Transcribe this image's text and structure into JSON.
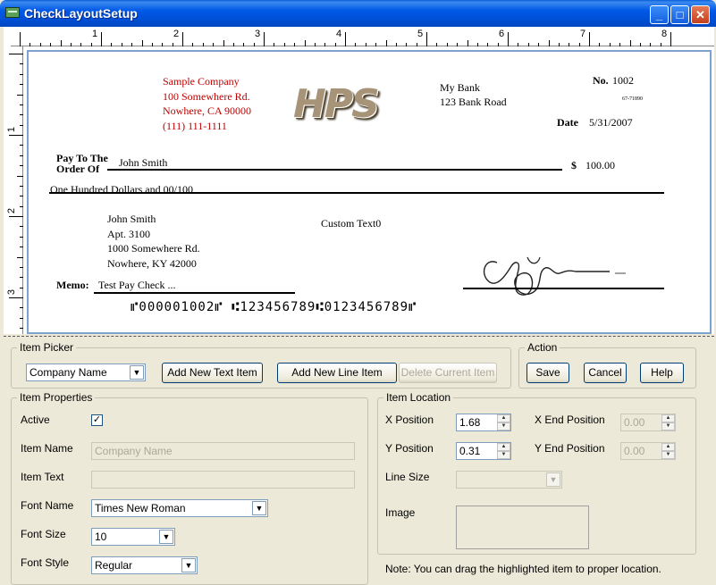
{
  "window": {
    "title": "CheckLayoutSetup",
    "controls": {
      "minimize": "_",
      "maximize": "□",
      "close": "✕"
    }
  },
  "ruler": {
    "horizontal": [
      "1",
      "2",
      "3",
      "4",
      "5",
      "6",
      "7",
      "8"
    ],
    "vertical": [
      "1",
      "2",
      "3"
    ]
  },
  "check": {
    "company": {
      "name": "Sample Company",
      "address1": "100 Somewhere Rd.",
      "address2": "Nowhere, CA 90000",
      "phone": "(111) 111-1111"
    },
    "logo": "HPS",
    "bank": {
      "name": "My Bank",
      "address": "123 Bank Road"
    },
    "number_label": "No.",
    "number": "1002",
    "fraction": "67-71890",
    "date_label": "Date",
    "date": "5/31/2007",
    "payto_label_1": "Pay To The",
    "payto_label_2": "Order Of",
    "payee": "John Smith",
    "currency": "$",
    "amount": "100.00",
    "amount_words": "One Hundred  Dollars and 00/100",
    "payee_address": {
      "name": "John Smith",
      "line1": "Apt. 3100",
      "line2": "1000 Somewhere Rd.",
      "line3": "Nowhere, KY 42000"
    },
    "custom_text": "Custom Text0",
    "memo_label": "Memo:",
    "memo": "Test Pay Check ...",
    "micr": "⑈000001002⑈ ⑆123456789⑆0123456789⑈"
  },
  "item_picker": {
    "label": "Item Picker",
    "selected": "Company Name",
    "add_text": "Add New Text Item",
    "add_line": "Add New Line Item",
    "delete": "Delete Current Item"
  },
  "action": {
    "label": "Action",
    "save": "Save",
    "cancel": "Cancel",
    "help": "Help"
  },
  "properties": {
    "label": "Item Properties",
    "active_label": "Active",
    "active_check": "✓",
    "name_label": "Item Name",
    "name_value": "Company Name",
    "text_label": "Item Text",
    "text_value": "",
    "font_name_label": "Font Name",
    "font_name": "Times New Roman",
    "font_size_label": "Font Size",
    "font_size": "10",
    "font_style_label": "Font Style",
    "font_style": "Regular"
  },
  "location": {
    "label": "Item Location",
    "x_label": "X Position",
    "x_value": "1.68",
    "y_label": "Y Position",
    "y_value": "0.31",
    "x_end_label": "X End Position",
    "x_end_value": "0.00",
    "y_end_label": "Y End Position",
    "y_end_value": "0.00",
    "line_size_label": "Line Size",
    "line_size_value": "",
    "image_label": "Image"
  },
  "note": "Note: You can drag the highlighted item to proper location."
}
